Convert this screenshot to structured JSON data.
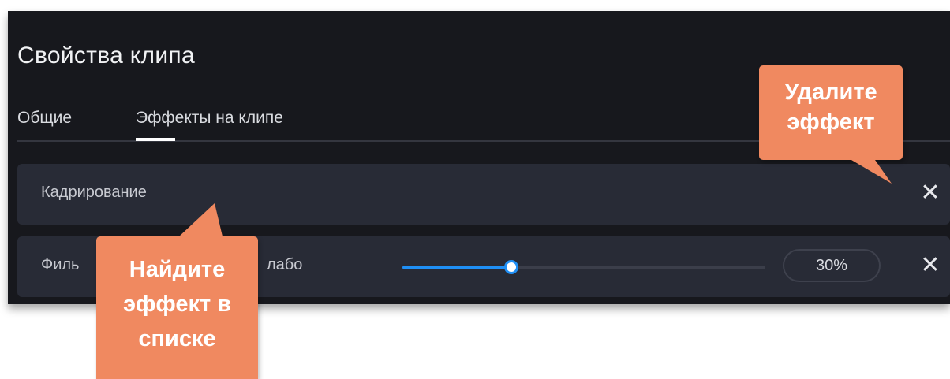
{
  "panel": {
    "title": "Свойства клипа",
    "tabs": [
      {
        "label": "Общие",
        "active": false
      },
      {
        "label": "Эффекты на клипе",
        "active": true
      }
    ]
  },
  "effects": [
    {
      "name": "Кадрирование",
      "remove_icon": "close-icon"
    },
    {
      "name_visible": "Филь",
      "name_suffix_visible": "лабо",
      "strength_value": 0.3,
      "strength_label": "30%",
      "remove_icon": "close-icon"
    }
  ],
  "callouts": {
    "delete": {
      "line1": "Удалите",
      "line2": "эффект"
    },
    "find": {
      "line1": "Найдите",
      "line2": "эффект в",
      "line3": "списке"
    }
  },
  "colors": {
    "panel_bg": "#17181d",
    "row_bg": "#282b36",
    "accent": "#1f8ff5",
    "callout": "#f08960"
  }
}
